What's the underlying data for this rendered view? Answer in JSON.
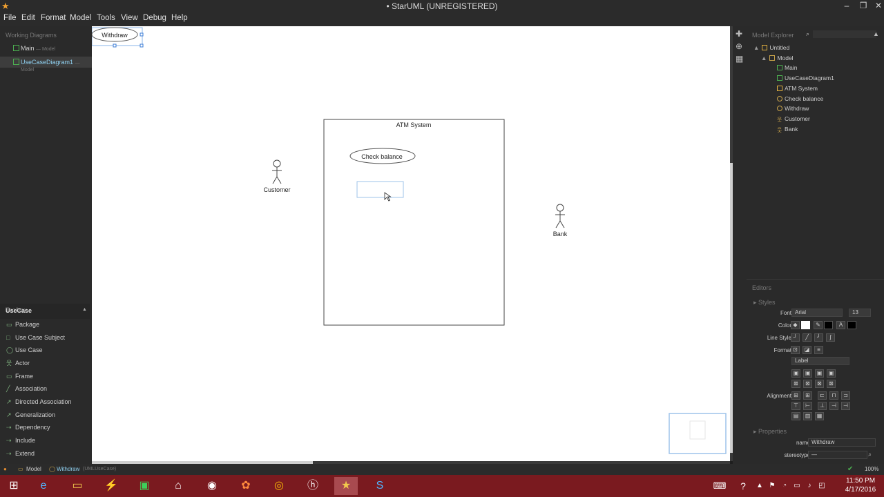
{
  "window": {
    "title": "• StarUML (UNREGISTERED)"
  },
  "menu": [
    "File",
    "Edit",
    "Format",
    "Model",
    "Tools",
    "View",
    "Debug",
    "Help"
  ],
  "working_diagrams": {
    "title": "Working Diagrams",
    "items": [
      {
        "label": "Main",
        "sub": "— Model"
      },
      {
        "label": "UseCaseDiagram1",
        "sub": "— Model"
      }
    ]
  },
  "toolbox": {
    "title": "Toolbox",
    "group": "UseCase",
    "items": [
      "Package",
      "Use Case Subject",
      "Use Case",
      "Actor",
      "Frame",
      "Association",
      "Directed Association",
      "Generalization",
      "Dependency",
      "Include",
      "Extend"
    ]
  },
  "diagram": {
    "withdraw": "Withdraw",
    "subject": "ATM System",
    "check_balance": "Check balance",
    "actor_customer": "Customer",
    "actor_bank": "Bank"
  },
  "explorer": {
    "title": "Model Explorer",
    "items": [
      {
        "label": "Untitled",
        "depth": 0
      },
      {
        "label": "Model",
        "depth": 1
      },
      {
        "label": "Main",
        "depth": 2
      },
      {
        "label": "UseCaseDiagram1",
        "depth": 2
      },
      {
        "label": "ATM System",
        "depth": 2
      },
      {
        "label": "Check balance",
        "depth": 2
      },
      {
        "label": "Withdraw",
        "depth": 2
      },
      {
        "label": "Customer",
        "depth": 2
      },
      {
        "label": "Bank",
        "depth": 2
      }
    ]
  },
  "editors": {
    "title": "Editors",
    "styles": "Styles",
    "font_label": "Font",
    "font_value": "Arial",
    "size_value": "13",
    "color_label": "Color",
    "line_style_label": "Line Style",
    "format_label": "Format",
    "format_value": "Label",
    "alignment_label": "Alignment",
    "properties": "Properties",
    "name_label": "name",
    "name_value": "Withdraw",
    "stereotype_label": "stereotype",
    "stereotype_value": "—"
  },
  "status": {
    "model": "Model",
    "selection": "Withdraw",
    "selection_type": "(UMLUseCase)",
    "zoom": "100%"
  },
  "taskbar": {
    "time": "11:50 PM",
    "date": "4/17/2016"
  },
  "colors": {
    "accent": "#8fd0f0",
    "taskbar": "#7a1a1f",
    "icon_green": "#4caf50"
  }
}
